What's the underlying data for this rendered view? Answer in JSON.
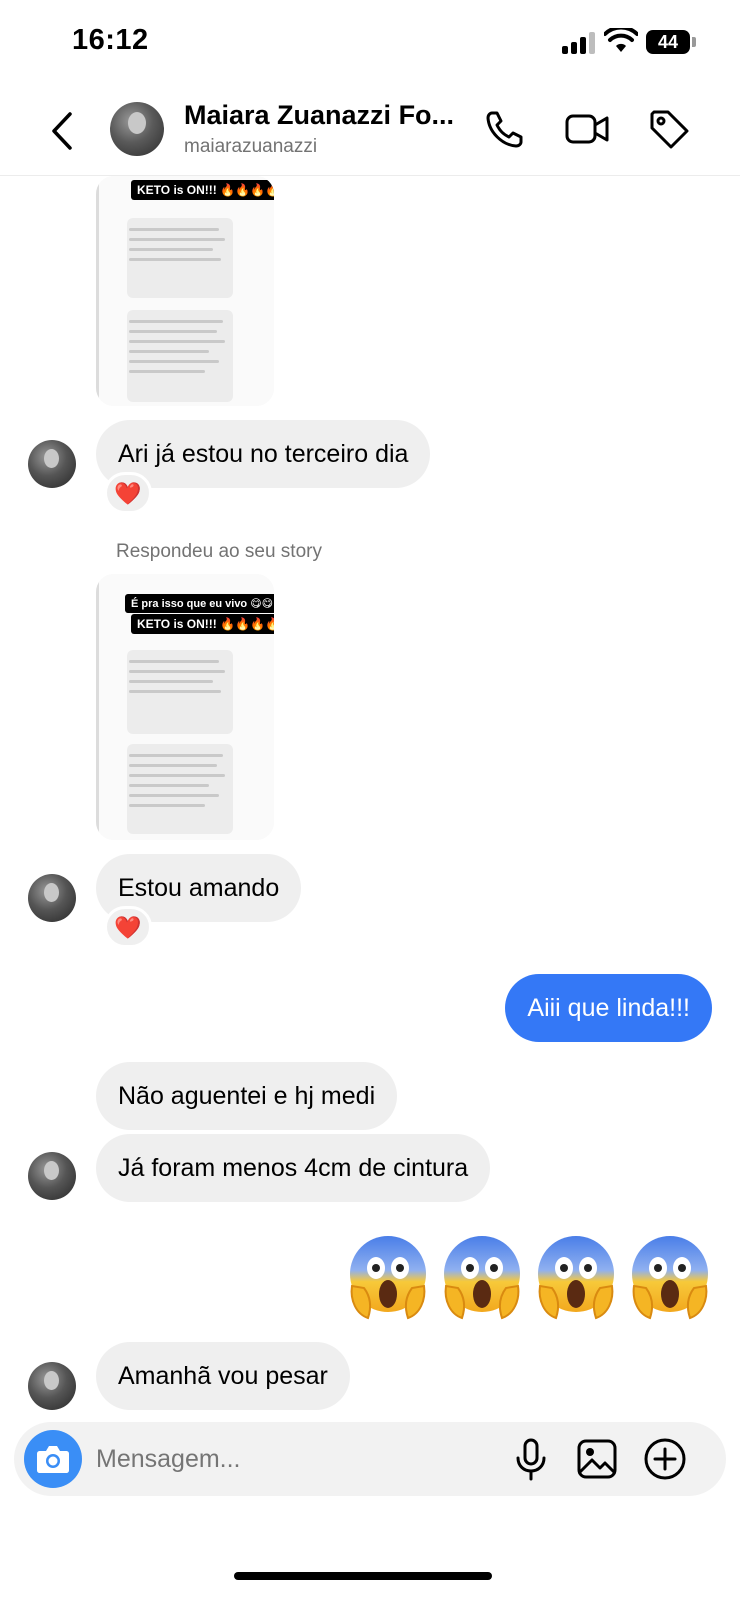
{
  "status_bar": {
    "time": "16:12",
    "battery": "44"
  },
  "header": {
    "contact_name": "Maiara Zuanazzi Fo...",
    "username": "maiarazuanazzi",
    "icons": [
      "back-chevron-icon",
      "phone-icon",
      "video-icon",
      "tag-icon"
    ]
  },
  "stories": [
    {
      "stickers": [
        "KETO is ON!!! 🔥🔥🔥🔥"
      ]
    },
    {
      "caption": "Respondeu ao seu story",
      "stickers": [
        "É pra isso que eu vivo 😋😋",
        "KETO is ON!!! 🔥🔥🔥🔥"
      ]
    }
  ],
  "messages": [
    {
      "from": "them",
      "text": "Ari já estou no terceiro dia",
      "reaction": "❤️"
    },
    {
      "from": "them",
      "text": "Estou amando",
      "reaction": "❤️"
    },
    {
      "from": "me",
      "text": "Aiii que linda!!!"
    },
    {
      "from": "them",
      "text": "Não aguentei e hj medi"
    },
    {
      "from": "them",
      "text": "Já foram menos 4cm de cintura"
    },
    {
      "from": "me",
      "emoji_count": 4,
      "emoji": "face-screaming-in-fear"
    },
    {
      "from": "them",
      "text": "Amanhã vou pesar"
    }
  ],
  "composer": {
    "placeholder": "Mensagem...",
    "icons": [
      "camera-icon",
      "microphone-icon",
      "gallery-icon",
      "plus-circle-icon"
    ]
  },
  "colors": {
    "outgoing_bubble": "#3478f6",
    "incoming_bubble": "#efefef",
    "camera_button": "#3a8ef6"
  }
}
